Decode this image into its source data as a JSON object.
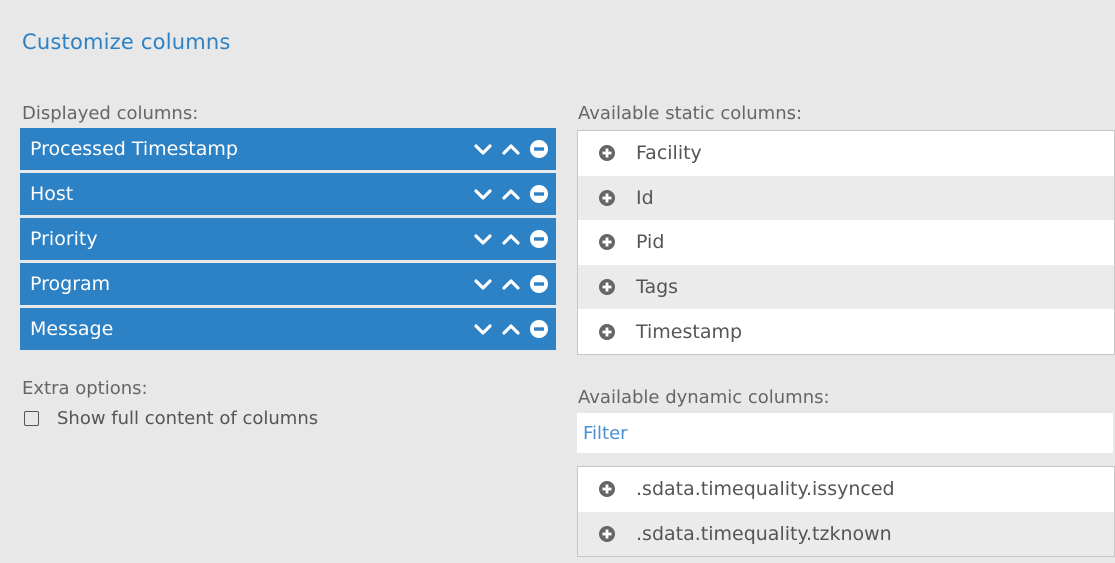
{
  "title": "Customize columns",
  "displayed": {
    "label": "Displayed columns:",
    "items": [
      {
        "label": "Processed Timestamp"
      },
      {
        "label": "Host"
      },
      {
        "label": "Priority"
      },
      {
        "label": "Program"
      },
      {
        "label": "Message"
      }
    ]
  },
  "extra": {
    "label": "Extra options:",
    "show_full_content": {
      "label": "Show full content of columns",
      "checked": false
    }
  },
  "static": {
    "label": "Available static columns:",
    "items": [
      {
        "label": "Facility"
      },
      {
        "label": "Id"
      },
      {
        "label": "Pid"
      },
      {
        "label": "Tags"
      },
      {
        "label": "Timestamp"
      }
    ]
  },
  "dynamic": {
    "label": "Available dynamic columns:",
    "filter_placeholder": "Filter",
    "items": [
      {
        "label": ".sdata.timequality.issynced"
      },
      {
        "label": ".sdata.timequality.tzknown"
      }
    ]
  },
  "colors": {
    "accent": "#2d81c5",
    "panel_bg": "#e8e8e8",
    "row_alt": "#ebebeb"
  },
  "icons": {
    "move_down": "chevron-down-icon",
    "move_up": "chevron-up-icon",
    "remove": "minus-circle-icon",
    "add": "plus-circle-icon"
  }
}
